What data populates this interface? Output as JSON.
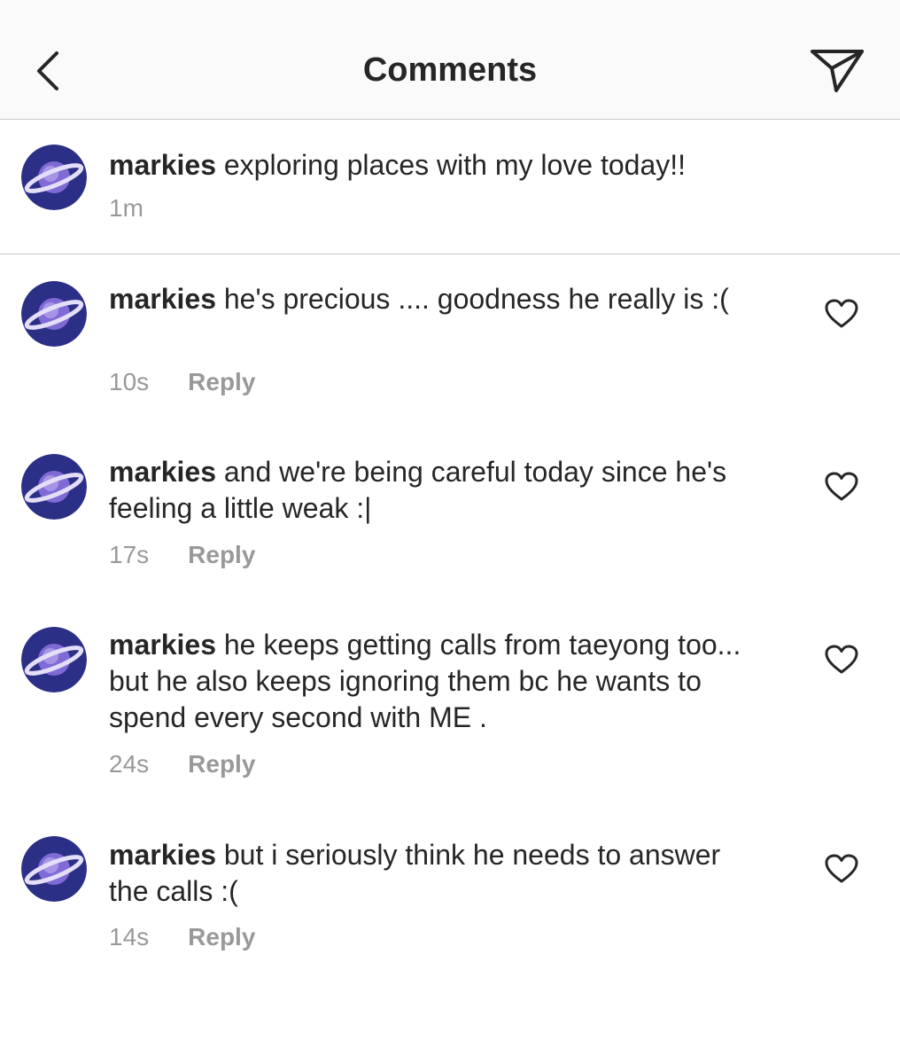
{
  "header": {
    "title": "Comments",
    "back_icon": "chevron-left-icon",
    "send_icon": "paper-plane-icon"
  },
  "caption": {
    "username": "markies",
    "text": "exploring places with my love today!!",
    "time": "1m"
  },
  "comments": [
    {
      "username": "markies",
      "text": "he's precious .... goodness he really is :(",
      "time": "10s",
      "reply_label": "Reply"
    },
    {
      "username": "markies",
      "text": "and we're being careful today since he's feeling a little weak :|",
      "time": "17s",
      "reply_label": "Reply"
    },
    {
      "username": "markies",
      "text": "he keeps getting calls from taeyong too... but he also keeps ignoring them bc he wants to spend every second with ME .",
      "time": "24s",
      "reply_label": "Reply"
    },
    {
      "username": "markies",
      "text": "but i seriously think he needs to answer the calls :(",
      "time": "14s",
      "reply_label": "Reply"
    }
  ],
  "colors": {
    "text": "#262626",
    "secondary": "#999999",
    "divider": "#c8c8c8",
    "avatar_bg": "#2b2f86"
  }
}
